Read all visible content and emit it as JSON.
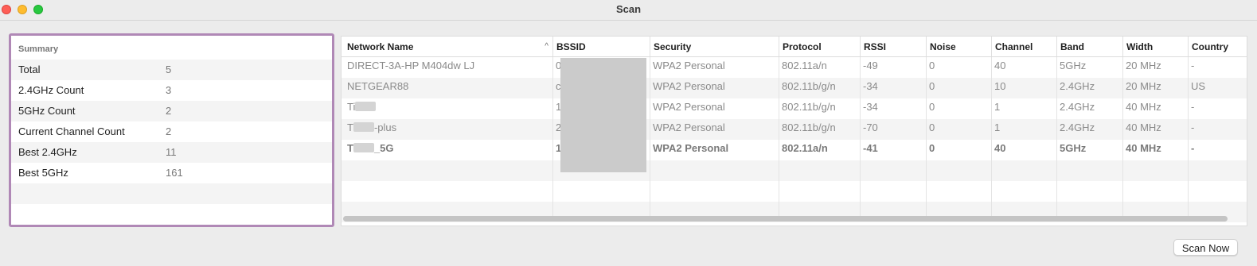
{
  "window": {
    "title": "Scan"
  },
  "summary": {
    "header": "Summary",
    "rows": [
      {
        "label": "Total",
        "value": "5"
      },
      {
        "label": "2.4GHz Count",
        "value": "3"
      },
      {
        "label": "5GHz Count",
        "value": "2"
      },
      {
        "label": "Current Channel Count",
        "value": "2"
      },
      {
        "label": "Best 2.4GHz",
        "value": "11"
      },
      {
        "label": "Best 5GHz",
        "value": "161"
      },
      {
        "label": "",
        "value": ""
      },
      {
        "label": "",
        "value": ""
      }
    ]
  },
  "table": {
    "columns": [
      "Network Name",
      "BSSID",
      "Security",
      "Protocol",
      "RSSI",
      "Noise",
      "Channel",
      "Band",
      "Width",
      "Country"
    ],
    "sort_indicator": "^",
    "rows": [
      {
        "name_pre": "DIRECT-3A-HP M404dw LJ",
        "name_redacted": false,
        "name_post": "",
        "bssid": "0",
        "security": "WPA2 Personal",
        "protocol": "802.11a/n",
        "rssi": "-49",
        "noise": "0",
        "channel": "40",
        "band": "5GHz",
        "width": "20 MHz",
        "country": "-",
        "bold": false
      },
      {
        "name_pre": "NETGEAR88",
        "name_redacted": false,
        "name_post": "",
        "bssid": "c",
        "security": "WPA2 Personal",
        "protocol": "802.11b/g/n",
        "rssi": "-34",
        "noise": "0",
        "channel": "10",
        "band": "2.4GHz",
        "width": "20 MHz",
        "country": "US",
        "bold": false
      },
      {
        "name_pre": "Ti",
        "name_redacted": true,
        "name_post": "",
        "bssid": "1",
        "security": "WPA2 Personal",
        "protocol": "802.11b/g/n",
        "rssi": "-34",
        "noise": "0",
        "channel": "1",
        "band": "2.4GHz",
        "width": "40 MHz",
        "country": "-",
        "bold": false
      },
      {
        "name_pre": "T",
        "name_redacted": true,
        "name_post": "-plus",
        "bssid": "2",
        "security": "WPA2 Personal",
        "protocol": "802.11b/g/n",
        "rssi": "-70",
        "noise": "0",
        "channel": "1",
        "band": "2.4GHz",
        "width": "40 MHz",
        "country": "-",
        "bold": false
      },
      {
        "name_pre": "T",
        "name_redacted": true,
        "name_post": "_5G",
        "bssid": "1",
        "security": "WPA2 Personal",
        "protocol": "802.11a/n",
        "rssi": "-41",
        "noise": "0",
        "channel": "40",
        "band": "5GHz",
        "width": "40 MHz",
        "country": "-",
        "bold": true
      }
    ]
  },
  "actions": {
    "scan_now": "Scan Now"
  },
  "colors": {
    "summary_border": "#b088b6",
    "row_stripe": "#f4f4f4",
    "redaction": "#cbcbcb"
  }
}
